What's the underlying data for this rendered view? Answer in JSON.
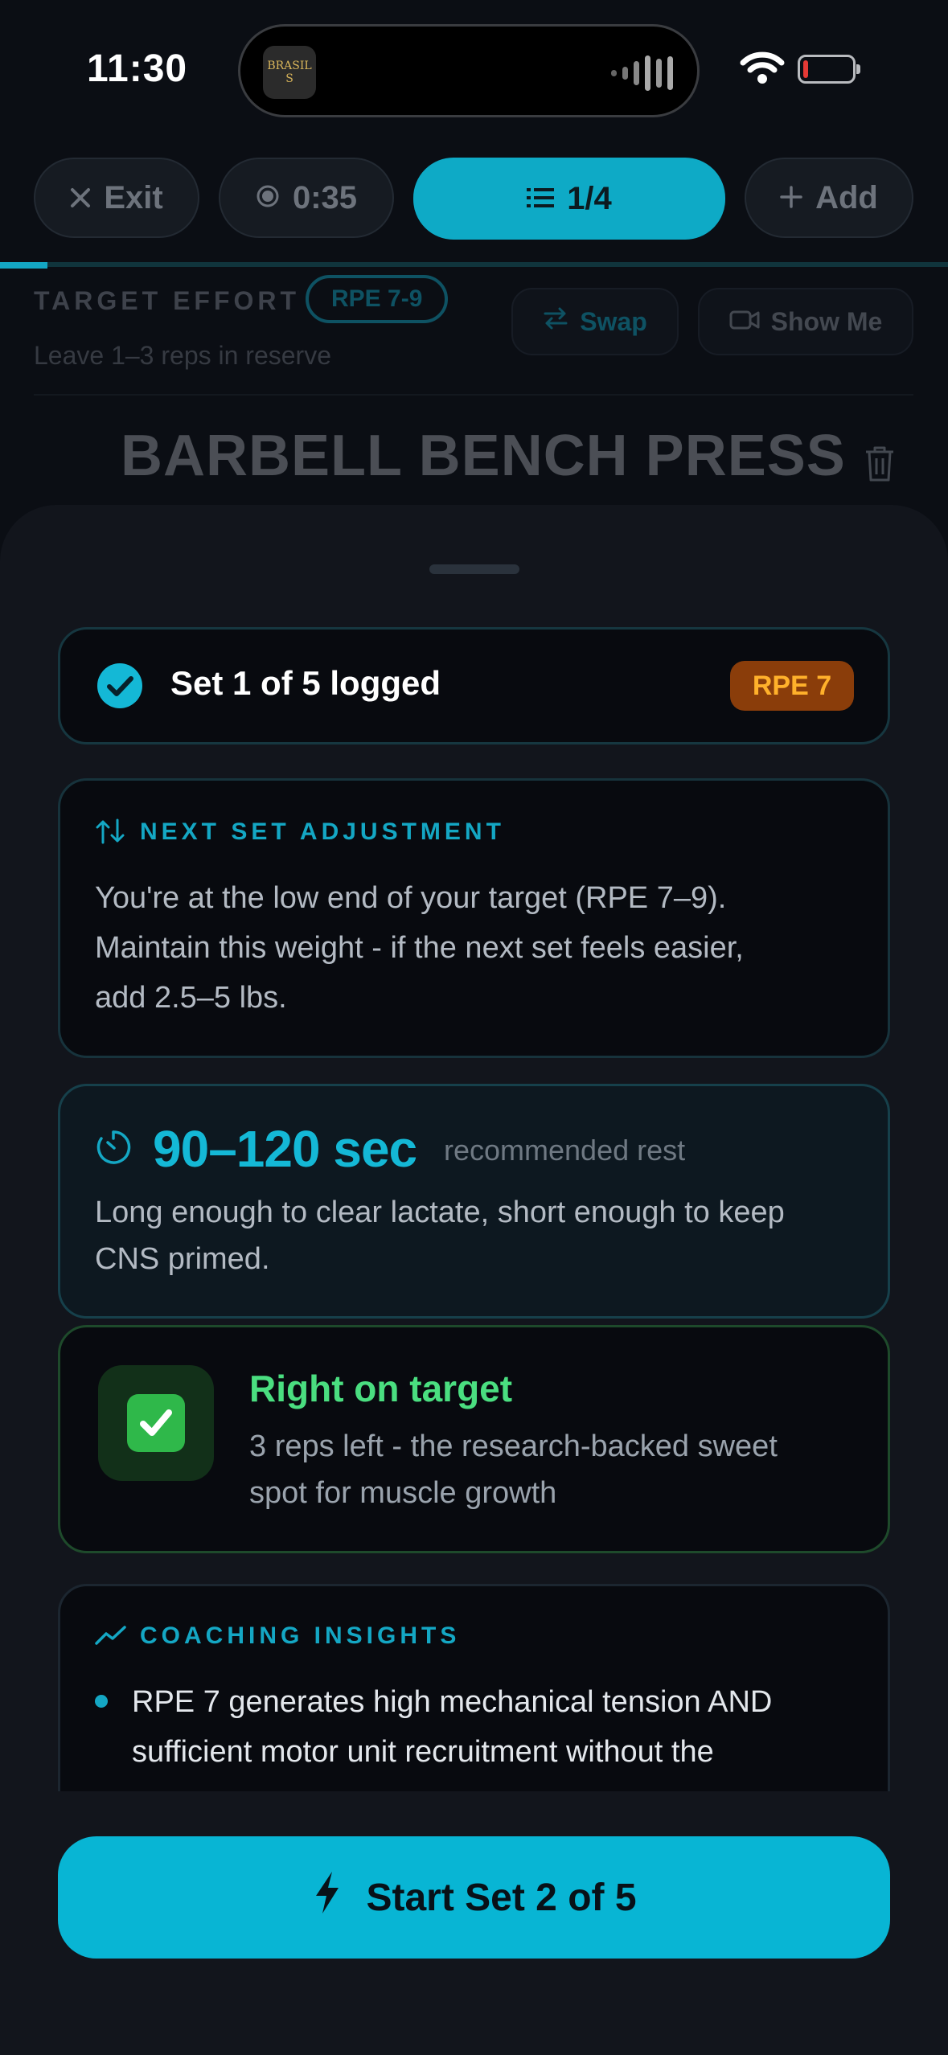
{
  "status_bar": {
    "time": "11:30",
    "app_thumb_line1": "BRASIL",
    "app_thumb_line2": "S"
  },
  "toolbar": {
    "exit_label": "Exit",
    "timer_value": "0:35",
    "exercise_counter": "1/4",
    "add_label": "Add",
    "workout_progress": 0.05
  },
  "header": {
    "target_effort_label": "TARGET EFFORT",
    "target_rpe_range": "RPE 7-9",
    "reserve_hint": "Leave 1–3 reps in reserve",
    "swap_label": "Swap",
    "show_me_label": "Show Me",
    "exercise_name": "BARBELL BENCH PRESS"
  },
  "sheet": {
    "logged": {
      "text": "Set 1 of 5 logged",
      "rpe_badge": "RPE 7"
    },
    "adjustment": {
      "label": "NEXT SET ADJUSTMENT",
      "line1": "You're at the low end of your target (RPE 7–9).",
      "line2": "Maintain this weight - if the next set feels easier,",
      "line3": "add 2.5–5 lbs."
    },
    "rest": {
      "value": "90–120 sec",
      "caption": "recommended rest",
      "line1": "Long enough to clear lactate, short enough to keep",
      "line2": "CNS primed."
    },
    "on_target": {
      "title": "Right on target",
      "line1": "3 reps left - the research-backed sweet",
      "line2": "spot for muscle growth"
    },
    "insights": {
      "label": "COACHING INSIGHTS",
      "bullet1_line1": "RPE 7 generates high mechanical tension AND",
      "bullet1_line2": "sufficient motor unit recruitment without the"
    },
    "cta_label": "Start Set 2 of 5"
  },
  "colors": {
    "accent": "#14a7c4",
    "success": "#4ade80",
    "rpe_badge_bg": "#8a3d0a",
    "rpe_badge_text": "#ffb12b"
  }
}
